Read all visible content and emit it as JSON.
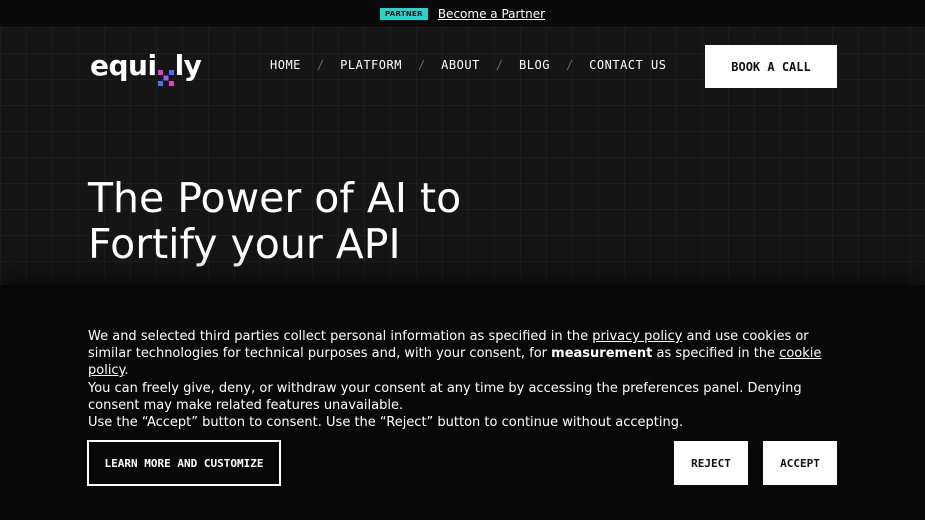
{
  "topbar": {
    "badge": "PARTNER",
    "link": "Become a Partner"
  },
  "header": {
    "logo_left": "equi",
    "logo_right": "ly",
    "nav": [
      "HOME",
      "PLATFORM",
      "ABOUT",
      "BLOG",
      "CONTACT US"
    ],
    "nav_separator": "/",
    "cta": "BOOK A CALL"
  },
  "hero": {
    "title_line1": "The Power of AI to",
    "title_line2": "Fortify your API"
  },
  "cookie": {
    "p1_a": "We and selected third parties collect personal information as specified in the ",
    "p1_link1": "privacy policy",
    "p1_b": " and use cookies or similar technologies for technical purposes and, with your consent, for ",
    "p1_bold": "measurement",
    "p1_c": " as specified in the ",
    "p1_link2": "cookie policy",
    "p1_d": ".",
    "p2": "You can freely give, deny, or withdraw your consent at any time by accessing the preferences panel. Denying consent may make related features unavailable.",
    "p3": "Use the “Accept” button to consent. Use the “Reject” button to continue without accepting.",
    "customize": "LEARN MORE AND CUSTOMIZE",
    "reject": "REJECT",
    "accept": "ACCEPT"
  },
  "colors": {
    "background": "#121212",
    "badge": "#1fd6d0",
    "logo_x_pink": "#e040c8",
    "logo_x_blue": "#4a6cff"
  }
}
